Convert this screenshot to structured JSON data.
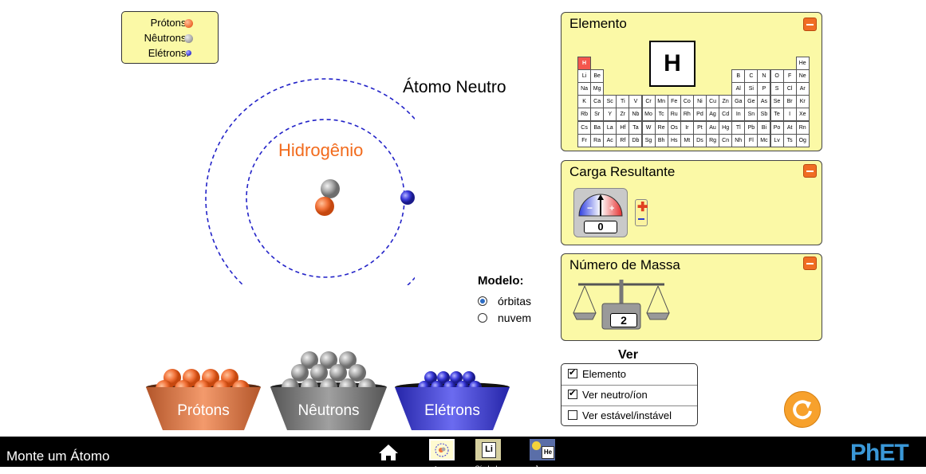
{
  "legend": {
    "protons_label": "Prótons:",
    "neutrons_label": "Nêutrons:",
    "electrons_label": "Elétrons:"
  },
  "atom": {
    "neutral_label": "Átomo Neutro",
    "element_name": "Hidrogênio",
    "protons": 1,
    "neutrons": 1,
    "electrons": 1
  },
  "model": {
    "title": "Modelo:",
    "options": [
      {
        "label": "órbitas",
        "selected": true
      },
      {
        "label": "nuvem",
        "selected": false
      }
    ]
  },
  "element_panel": {
    "title": "Elemento",
    "symbol": "H",
    "periodic_rows": [
      [
        "H",
        "",
        "",
        "",
        "",
        "",
        "",
        "",
        "",
        "",
        "",
        "",
        "",
        "",
        "",
        "",
        "",
        "He"
      ],
      [
        "Li",
        "Be",
        "",
        "",
        "",
        "",
        "",
        "",
        "",
        "",
        "",
        "",
        "B",
        "C",
        "N",
        "O",
        "F",
        "Ne"
      ],
      [
        "Na",
        "Mg",
        "",
        "",
        "",
        "",
        "",
        "",
        "",
        "",
        "",
        "",
        "Al",
        "Si",
        "P",
        "S",
        "Cl",
        "Ar"
      ],
      [
        "K",
        "Ca",
        "Sc",
        "Ti",
        "V",
        "Cr",
        "Mn",
        "Fe",
        "Co",
        "Ni",
        "Cu",
        "Zn",
        "Ga",
        "Ge",
        "As",
        "Se",
        "Br",
        "Kr"
      ],
      [
        "Rb",
        "Sr",
        "Y",
        "Zr",
        "Nb",
        "Mo",
        "Tc",
        "Ru",
        "Rh",
        "Pd",
        "Ag",
        "Cd",
        "In",
        "Sn",
        "Sb",
        "Te",
        "I",
        "Xe"
      ],
      [
        "Cs",
        "Ba",
        "La",
        "Hf",
        "Ta",
        "W",
        "Re",
        "Os",
        "Ir",
        "Pt",
        "Au",
        "Hg",
        "Tl",
        "Pb",
        "Bi",
        "Po",
        "At",
        "Rn"
      ],
      [
        "Fr",
        "Ra",
        "Ac",
        "Rf",
        "Db",
        "Sg",
        "Bh",
        "Hs",
        "Mt",
        "Ds",
        "Rg",
        "Cn",
        "Nh",
        "Fl",
        "Mc",
        "Lv",
        "Ts",
        "Og"
      ]
    ],
    "selected_symbol": "H"
  },
  "charge_panel": {
    "title": "Carga Resultante",
    "value": "0"
  },
  "mass_panel": {
    "title": "Número de Massa",
    "value": "2"
  },
  "view": {
    "title": "Ver",
    "options": [
      {
        "label": "Elemento",
        "checked": true
      },
      {
        "label": "Ver neutro/íon",
        "checked": true
      },
      {
        "label": "Ver estável/instável",
        "checked": false
      }
    ]
  },
  "buckets": {
    "protons": "Prótons",
    "neutrons": "Nêutrons",
    "electrons": "Elétrons"
  },
  "navbar": {
    "app_title": "Monte um Átomo",
    "screens": [
      "Átomo",
      "Símbolo",
      "Jogo"
    ],
    "screen_icon_symbols": [
      "",
      "Li",
      "He"
    ],
    "logo": "PhET"
  },
  "colors": {
    "proton": "#f2743b",
    "neutron": "#a8a8a8",
    "electron": "#3c3cdc",
    "panel": "#fbf9a6",
    "accent": "#f06d23"
  }
}
